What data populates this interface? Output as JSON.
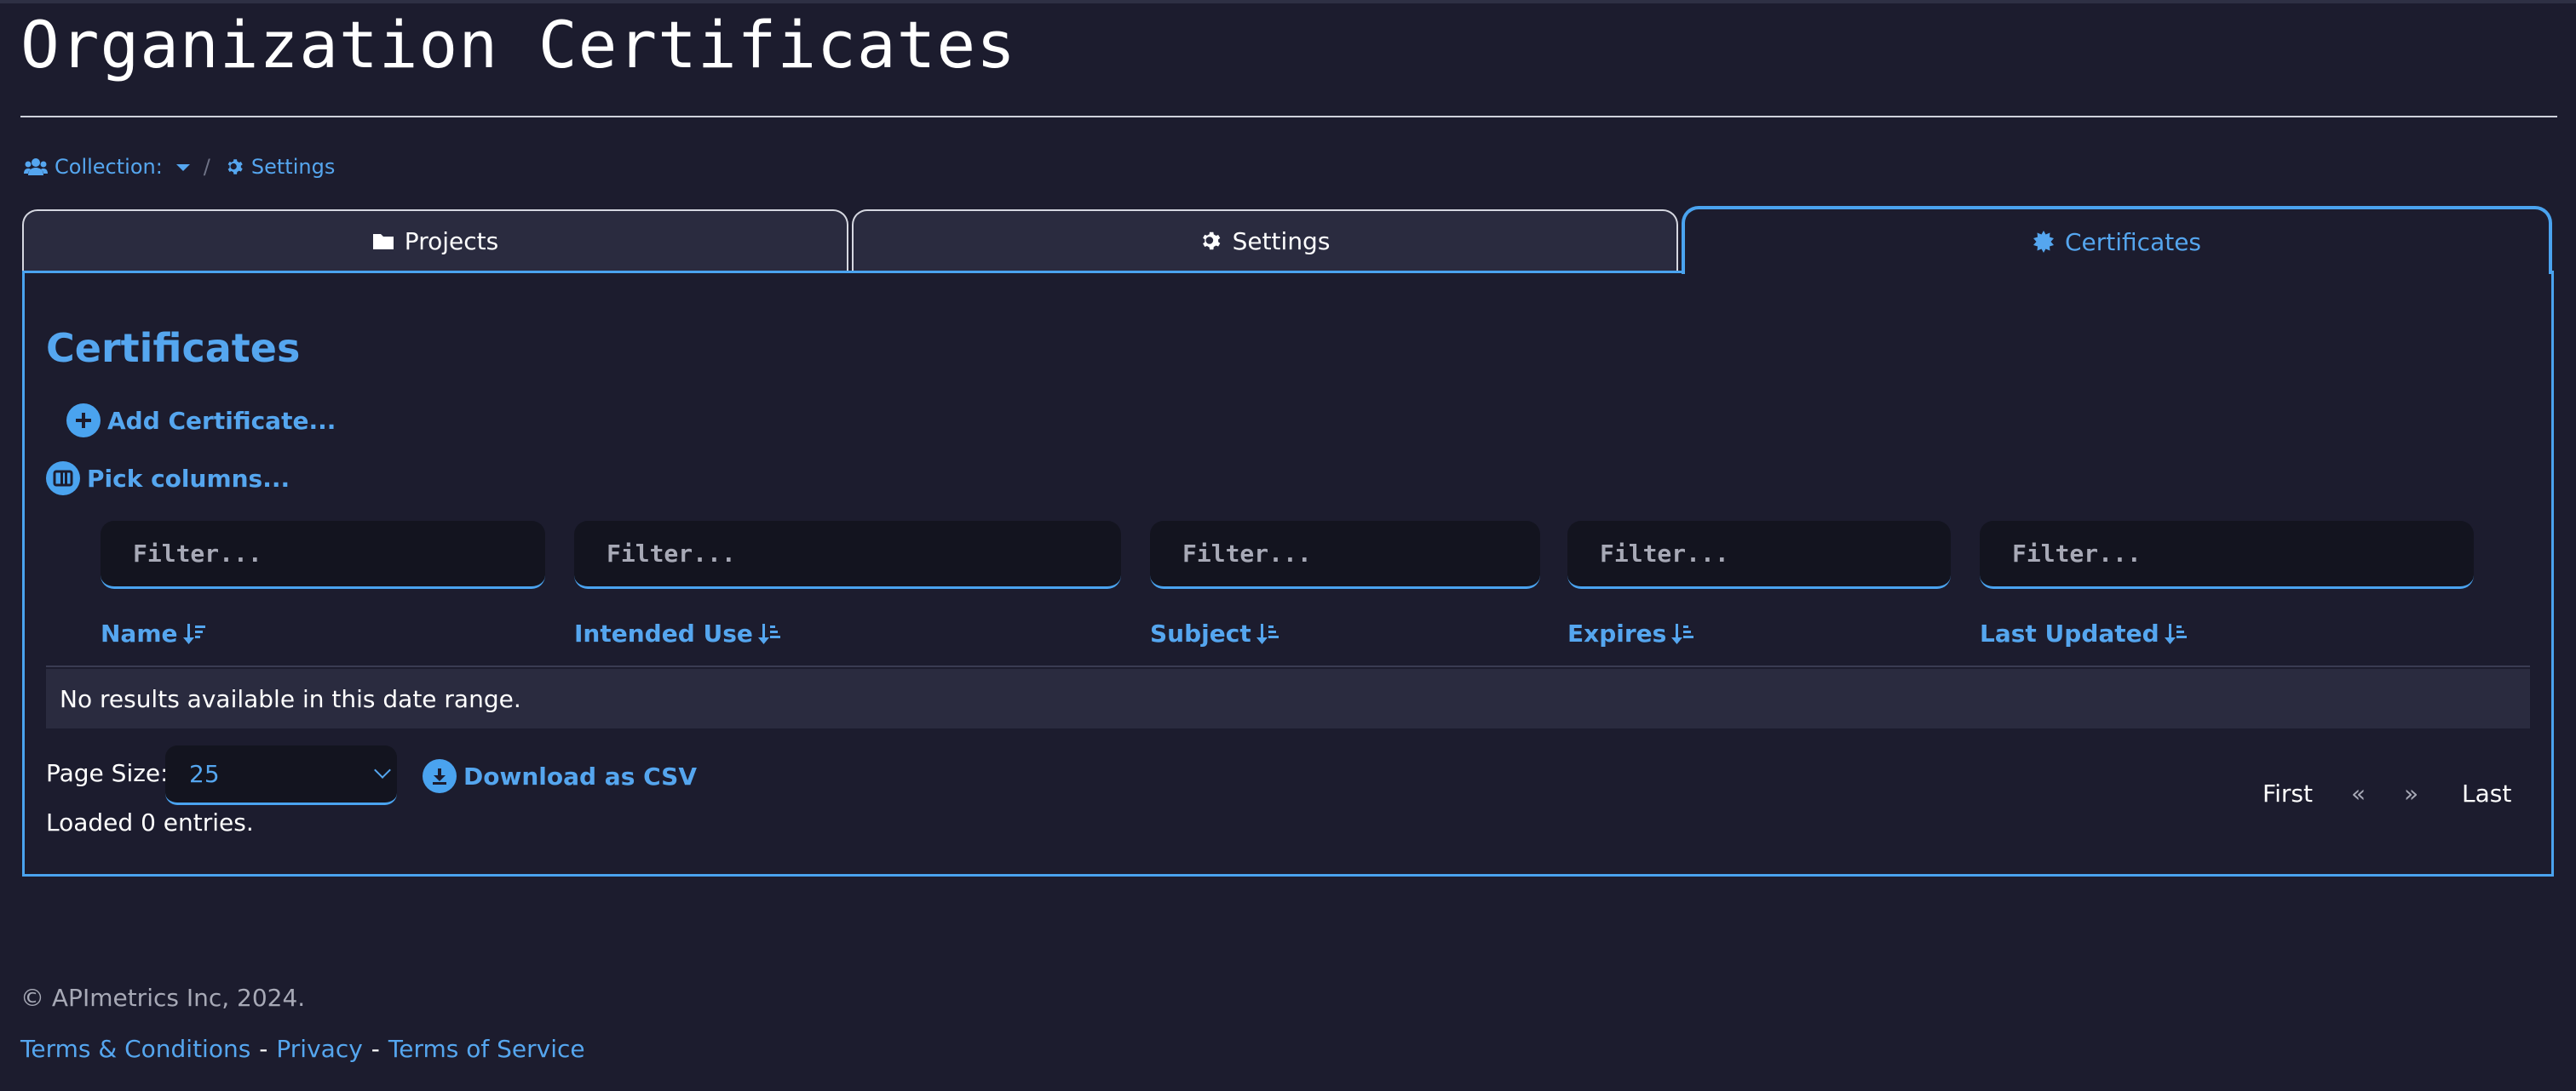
{
  "page": {
    "title": "Organization Certificates"
  },
  "breadcrumb": {
    "collection_label": "Collection:",
    "separator": "/",
    "settings_label": "Settings"
  },
  "tabs": [
    {
      "label": "Projects",
      "icon": "folder-icon"
    },
    {
      "label": "Settings",
      "icon": "gear-icon"
    },
    {
      "label": "Certificates",
      "icon": "certificate-icon",
      "active": true
    }
  ],
  "section": {
    "title": "Certificates",
    "add_label": "Add Certificate...",
    "pick_columns_label": "Pick columns..."
  },
  "table": {
    "filter_placeholder": "Filter...",
    "columns": [
      "Name",
      "Intended Use",
      "Subject",
      "Expires",
      "Last Updated"
    ],
    "empty_message": "No results available in this date range."
  },
  "footer_controls": {
    "page_size_label": "Page Size:",
    "page_size_value": "25",
    "download_label": "Download as CSV",
    "loaded_text": "Loaded 0 entries.",
    "pagination": {
      "first": "First",
      "prev": "«",
      "next": "»",
      "last": "Last"
    }
  },
  "footer": {
    "copyright": "© APImetrics Inc, 2024.",
    "links": [
      "Terms & Conditions",
      "Privacy",
      "Terms of Service"
    ],
    "separator": "-"
  },
  "colors": {
    "accent": "#4aa3ef",
    "background": "#1c1c2e",
    "tab_bg": "#2a2b3f",
    "input_bg": "#13141f"
  }
}
